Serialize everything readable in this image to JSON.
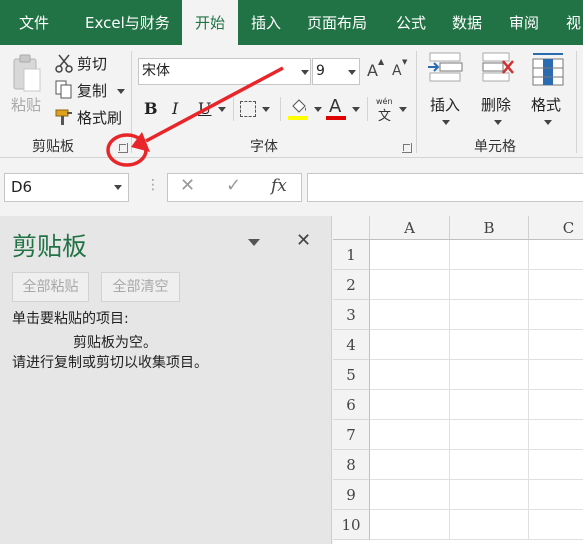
{
  "tabs": [
    "文件",
    "Excel与财务",
    "开始",
    "插入",
    "页面布局",
    "公式",
    "数据",
    "审阅",
    "视"
  ],
  "clipboard": {
    "paste_label": "粘贴",
    "cut_label": "剪切",
    "copy_label": "复制",
    "format_painter_label": "格式刷",
    "group_label": "剪贴板"
  },
  "font": {
    "font_name": "宋体",
    "font_size": "9",
    "grow_label": "A",
    "shrink_label": "A",
    "bold_label": "B",
    "italic_label": "I",
    "underline_label": "U",
    "font_color_label": "A",
    "phonetic_label": "wén",
    "phonetic_char": "文",
    "group_label": "字体"
  },
  "cells": {
    "insert_label": "插入",
    "delete_label": "删除",
    "format_label": "格式",
    "group_label": "单元格"
  },
  "formula_bar": {
    "name_box": "D6",
    "fx_label": "fx",
    "formula": ""
  },
  "clipboard_pane": {
    "title": "剪贴板",
    "paste_all": "全部粘贴",
    "clear_all": "全部清空",
    "instruction": "单击要粘贴的项目:",
    "empty_line1": "剪贴板为空。",
    "empty_line2": "请进行复制或剪切以收集项目。"
  },
  "sheet": {
    "columns": [
      "A",
      "B",
      "C"
    ],
    "rows": [
      "1",
      "2",
      "3",
      "4",
      "5",
      "6",
      "7",
      "8",
      "9",
      "10"
    ]
  },
  "colors": {
    "brand": "#217346",
    "annotation": "#e8262a",
    "highlight_yellow": "#ffff00",
    "font_red": "#e00000"
  }
}
